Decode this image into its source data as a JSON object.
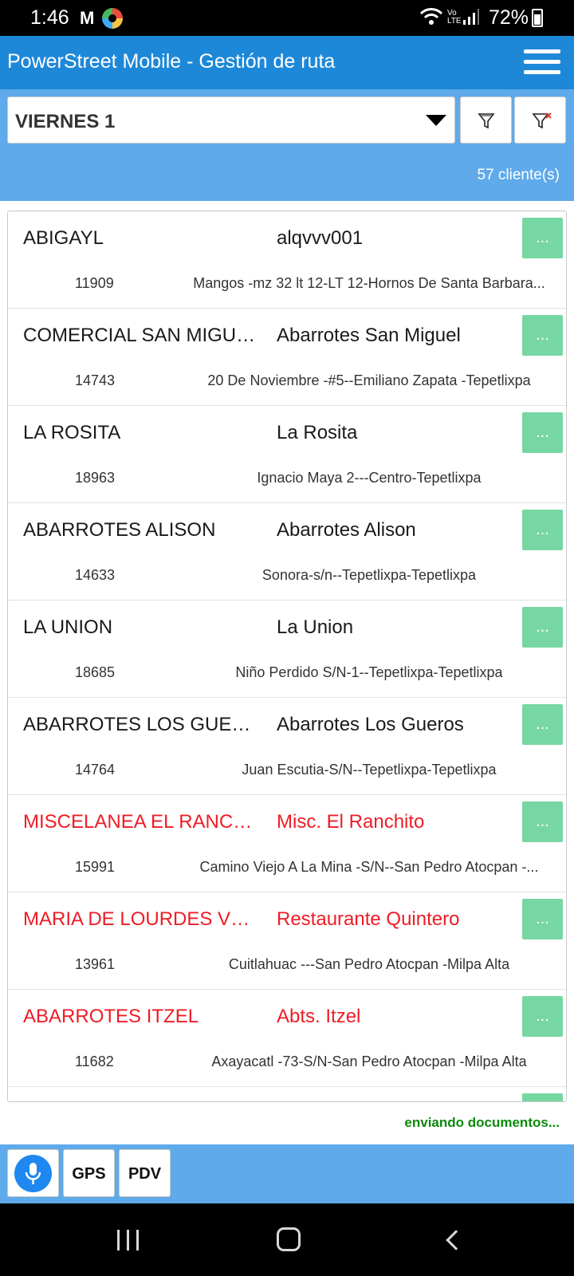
{
  "status_bar": {
    "time": "1:46",
    "notification_icons": [
      "gmail-icon",
      "app-icon"
    ],
    "gmail_glyph": "M",
    "volte": "Vo\nLTE",
    "battery": "72%"
  },
  "header": {
    "title": "PowerStreet Mobile - Gestión de ruta",
    "menu_icon": "hamburger-menu-icon"
  },
  "filter": {
    "selected_day": "VIERNES 1",
    "filter_icon": "filter-icon",
    "clear_filter_icon": "filter-clear-icon",
    "client_count": "57 cliente(s)"
  },
  "clients": [
    {
      "name": "ABIGAYL",
      "business": "alqvvv001",
      "code": "11909",
      "address": "Mangos -mz 32 lt 12-LT 12-Hornos De Santa Barbara...",
      "highlight": false,
      "more_label": "..."
    },
    {
      "name": "COMERCIAL SAN MIGUEL",
      "business": "Abarrotes San Miguel",
      "code": "14743",
      "address": "20 De Noviembre -#5--Emiliano Zapata -Tepetlixpa",
      "highlight": false,
      "more_label": "..."
    },
    {
      "name": "LA ROSITA",
      "business": "La Rosita",
      "code": "18963",
      "address": "Ignacio Maya 2---Centro-Tepetlixpa",
      "highlight": false,
      "more_label": "..."
    },
    {
      "name": "ABARROTES ALISON",
      "business": "Abarrotes Alison",
      "code": "14633",
      "address": "Sonora-s/n--Tepetlixpa-Tepetlixpa",
      "highlight": false,
      "more_label": "..."
    },
    {
      "name": "LA UNION",
      "business": "La Union",
      "code": "18685",
      "address": "Niño Perdido S/N-1--Tepetlixpa-Tepetlixpa",
      "highlight": false,
      "more_label": "..."
    },
    {
      "name": "ABARROTES LOS GUEROS",
      "business": "Abarrotes Los Gueros",
      "code": "14764",
      "address": "Juan Escutia-S/N--Tepetlixpa-Tepetlixpa",
      "highlight": false,
      "more_label": "..."
    },
    {
      "name": "MISCELANEA EL RANCHITO",
      "business": "Misc. El Ranchito",
      "code": "15991",
      "address": "Camino Viejo A La Mina -S/N--San Pedro Atocpan -...",
      "highlight": true,
      "more_label": "..."
    },
    {
      "name": "MARIA DE LOURDES VEGA",
      "business": "Restaurante Quintero",
      "code": "13961",
      "address": "Cuitlahuac ---San Pedro Atocpan -Milpa Alta",
      "highlight": true,
      "more_label": "..."
    },
    {
      "name": "ABARROTES ITZEL",
      "business": "Abts. Itzel",
      "code": "11682",
      "address": "Axayacatl -73-S/N-San Pedro Atocpan -Milpa Alta",
      "highlight": true,
      "more_label": "..."
    }
  ],
  "sync_status": "enviando documentos...",
  "toolbar": {
    "mic_icon": "microphone-icon",
    "gps_label": "GPS",
    "pdv_label": "PDV"
  },
  "nav_bar": {
    "recent_icon": "recent-apps-icon",
    "home_icon": "home-icon",
    "back_icon": "back-icon"
  },
  "colors": {
    "header_blue": "#1e88d8",
    "panel_blue": "#5eaaea",
    "action_green": "#76d7a3",
    "alert_red": "#ee1c25",
    "status_green": "#0b8a0b"
  }
}
